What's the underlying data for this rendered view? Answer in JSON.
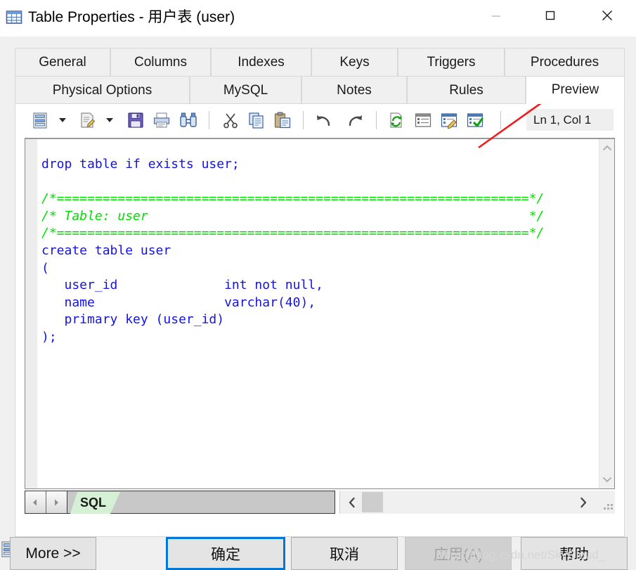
{
  "window": {
    "title": "Table Properties - 用户表 (user)",
    "icon": "table-icon",
    "controls": {
      "minimize": "minimize-icon",
      "maximize": "maximize-icon",
      "close": "close-icon"
    }
  },
  "tabs": {
    "row1": [
      {
        "label": "General",
        "selected": false
      },
      {
        "label": "Columns",
        "selected": false
      },
      {
        "label": "Indexes",
        "selected": false
      },
      {
        "label": "Keys",
        "selected": false
      },
      {
        "label": "Triggers",
        "selected": false
      },
      {
        "label": "Procedures",
        "selected": false
      }
    ],
    "row2": [
      {
        "label": "Physical Options",
        "selected": false
      },
      {
        "label": "MySQL",
        "selected": false
      },
      {
        "label": "Notes",
        "selected": false
      },
      {
        "label": "Rules",
        "selected": false
      },
      {
        "label": "Preview",
        "selected": true
      }
    ]
  },
  "toolbar": {
    "buttons": [
      {
        "name": "preview-mode-button",
        "icon": "report-icon",
        "dropdown": true
      },
      {
        "name": "edit-button",
        "icon": "edit-document-icon",
        "dropdown": true
      },
      {
        "name": "save-button",
        "icon": "floppy-disk-icon",
        "dropdown": false
      },
      {
        "name": "print-button",
        "icon": "printer-icon",
        "dropdown": false
      },
      {
        "name": "find-button",
        "icon": "binoculars-icon",
        "dropdown": false
      },
      {
        "name": "cut-button",
        "icon": "scissors-icon",
        "dropdown": false
      },
      {
        "name": "copy-button",
        "icon": "copy-icon",
        "dropdown": false
      },
      {
        "name": "paste-button",
        "icon": "clipboard-paste-icon",
        "dropdown": false
      },
      {
        "name": "undo-button",
        "icon": "undo-arrow-icon",
        "dropdown": false
      },
      {
        "name": "redo-button",
        "icon": "redo-arrow-icon",
        "dropdown": false
      },
      {
        "name": "refresh-button",
        "icon": "refresh-page-icon",
        "dropdown": false
      },
      {
        "name": "properties-button",
        "icon": "window-list-icon",
        "dropdown": false
      },
      {
        "name": "edit-script-button",
        "icon": "window-pencil-icon",
        "dropdown": false
      },
      {
        "name": "check-script-button",
        "icon": "window-check-icon",
        "dropdown": false
      }
    ],
    "status": "Ln 1, Col 1"
  },
  "editor": {
    "lines": [
      {
        "text": "drop table if exists user;",
        "kind": "code"
      },
      {
        "text": "",
        "kind": "code"
      },
      {
        "text": "/*==============================================================*/",
        "kind": "comment"
      },
      {
        "text": "/* Table: user                                                  */",
        "kind": "comment"
      },
      {
        "text": "/*==============================================================*/",
        "kind": "comment"
      },
      {
        "text": "create table user",
        "kind": "code"
      },
      {
        "text": "(",
        "kind": "code"
      },
      {
        "text": "   user_id              int not null,",
        "kind": "code"
      },
      {
        "text": "   name                 varchar(40),",
        "kind": "code"
      },
      {
        "text": "   primary key (user_id)",
        "kind": "code"
      },
      {
        "text": ");",
        "kind": "code"
      }
    ],
    "colors": {
      "code": "#1414E0",
      "comment": "#00E000"
    },
    "scrollbar": {
      "up": "chevron-up-icon",
      "down": "chevron-down-icon"
    }
  },
  "sheetbar": {
    "prev": "prev-arrow-icon",
    "next": "next-arrow-icon",
    "tabs": [
      {
        "label": "SQL",
        "selected": true
      }
    ],
    "hscroll": {
      "left": "scroll-left-icon",
      "right": "scroll-right-icon"
    }
  },
  "footer": {
    "more": "More >>",
    "print_icon": "report-icon",
    "ok": "确定",
    "cancel": "取消",
    "apply": "应用(A)",
    "help": "帮助"
  },
  "annotation": {
    "type": "arrow",
    "color": "#ee1c1c",
    "points_to": "Preview"
  },
  "watermark": "https://blog.csdn.net/SkyCloud_"
}
